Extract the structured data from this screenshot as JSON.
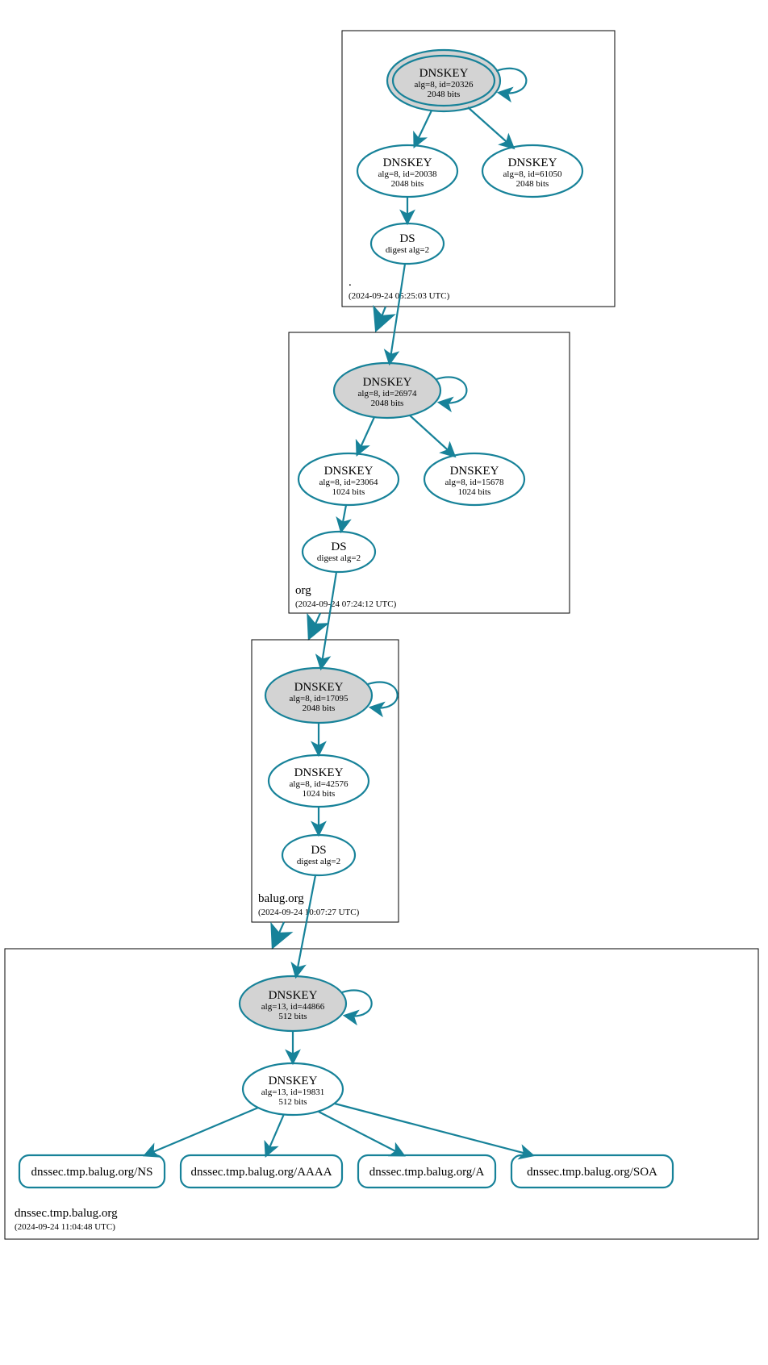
{
  "colors": {
    "stroke": "#178299",
    "ksk_fill": "#d3d3d3"
  },
  "zones": {
    "root": {
      "name": ".",
      "ts": "(2024-09-24 05:25:03 UTC)"
    },
    "org": {
      "name": "org",
      "ts": "(2024-09-24 07:24:12 UTC)"
    },
    "balug": {
      "name": "balug.org",
      "ts": "(2024-09-24 10:07:27 UTC)"
    },
    "leaf": {
      "name": "dnssec.tmp.balug.org",
      "ts": "(2024-09-24 11:04:48 UTC)"
    }
  },
  "root": {
    "ksk": {
      "t": "DNSKEY",
      "l1": "alg=8, id=20326",
      "l2": "2048 bits"
    },
    "zsk1": {
      "t": "DNSKEY",
      "l1": "alg=8, id=20038",
      "l2": "2048 bits"
    },
    "zsk2": {
      "t": "DNSKEY",
      "l1": "alg=8, id=61050",
      "l2": "2048 bits"
    },
    "ds": {
      "t": "DS",
      "l1": "digest alg=2"
    }
  },
  "org": {
    "ksk": {
      "t": "DNSKEY",
      "l1": "alg=8, id=26974",
      "l2": "2048 bits"
    },
    "zsk1": {
      "t": "DNSKEY",
      "l1": "alg=8, id=23064",
      "l2": "1024 bits"
    },
    "zsk2": {
      "t": "DNSKEY",
      "l1": "alg=8, id=15678",
      "l2": "1024 bits"
    },
    "ds": {
      "t": "DS",
      "l1": "digest alg=2"
    }
  },
  "balug": {
    "ksk": {
      "t": "DNSKEY",
      "l1": "alg=8, id=17095",
      "l2": "2048 bits"
    },
    "zsk": {
      "t": "DNSKEY",
      "l1": "alg=8, id=42576",
      "l2": "1024 bits"
    },
    "ds": {
      "t": "DS",
      "l1": "digest alg=2"
    }
  },
  "leaf": {
    "ksk": {
      "t": "DNSKEY",
      "l1": "alg=13, id=44866",
      "l2": "512 bits"
    },
    "zsk": {
      "t": "DNSKEY",
      "l1": "alg=13, id=19831",
      "l2": "512 bits"
    }
  },
  "rrsets": {
    "ns": "dnssec.tmp.balug.org/NS",
    "aaaa": "dnssec.tmp.balug.org/AAAA",
    "a": "dnssec.tmp.balug.org/A",
    "soa": "dnssec.tmp.balug.org/SOA"
  }
}
